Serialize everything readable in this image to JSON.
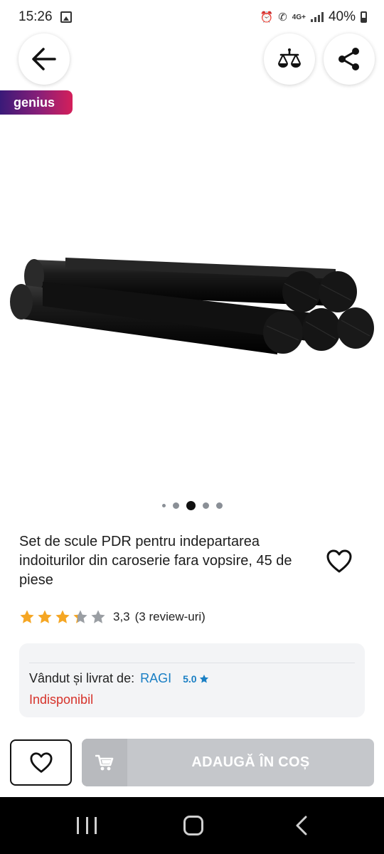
{
  "status_bar": {
    "time": "15:26",
    "network": "4G+",
    "battery": "40%"
  },
  "icons": {
    "back": "arrow-left-icon",
    "compare": "balance-scale-icon",
    "share": "share-icon",
    "favorite": "heart-icon",
    "cart": "cart-icon"
  },
  "badge": {
    "label": "genius"
  },
  "gallery": {
    "images_total": 5,
    "active_index": 2
  },
  "product": {
    "title": "Set de scule PDR pentru indepartarea indoiturilor din caroserie fara vopsire, 45 de piese",
    "rating": {
      "stars_filled": 3.3,
      "stars_total": 5,
      "value": "3,3",
      "count_label": "(3 review-uri)"
    }
  },
  "seller": {
    "label": "Vândut și livrat de:",
    "name": "RAGI",
    "score": "5.0",
    "availability": "Indisponibil"
  },
  "actions": {
    "add_to_cart": "ADAUGĂ ÎN COȘ"
  },
  "colors": {
    "accent_blue": "#1a7fc4",
    "unavailable_red": "#d6322a",
    "star_gold": "#f5a623",
    "star_grey": "#9a9ea3",
    "cart_disabled": "#c5c7cb"
  }
}
